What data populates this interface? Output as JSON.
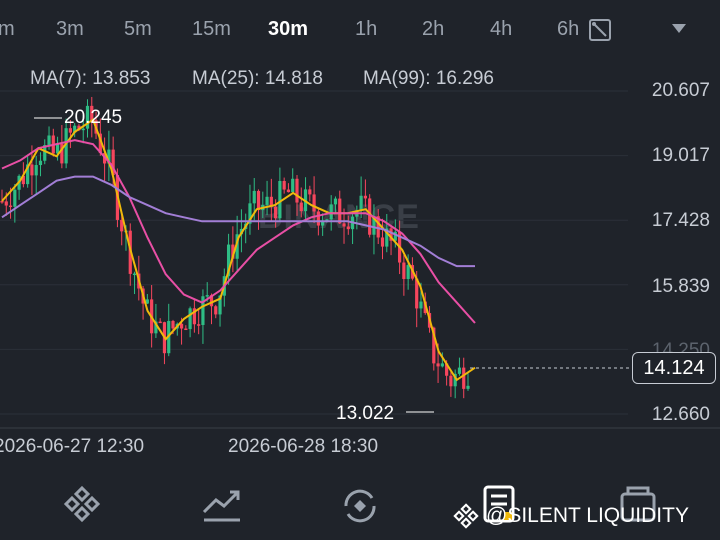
{
  "timeframes": [
    {
      "label": "m",
      "active": false
    },
    {
      "label": "3m",
      "active": false
    },
    {
      "label": "5m",
      "active": false
    },
    {
      "label": "15m",
      "active": false
    },
    {
      "label": "30m",
      "active": true
    },
    {
      "label": "1h",
      "active": false
    },
    {
      "label": "2h",
      "active": false
    },
    {
      "label": "4h",
      "active": false
    },
    {
      "label": "6h",
      "active": false
    }
  ],
  "ma": {
    "ma7": {
      "label": "MA(7): 13.853",
      "color": "#f0b90b"
    },
    "ma25": {
      "label": "MA(25): 14.818",
      "color": "#e84fa5"
    },
    "ma99": {
      "label": "MA(99): 16.296",
      "color": "#a27ed6"
    }
  },
  "colors": {
    "up": "#2ebd85",
    "down": "#f6465d"
  },
  "watermark": "BINANCE",
  "annotations": {
    "high": "20.245",
    "low": "13.022"
  },
  "current_price": "14.124",
  "icons": [
    "drawing-tools-icon",
    "chevron-down-icon",
    "markets-icon",
    "trade-icon",
    "orders-icon",
    "wallet-icon"
  ],
  "credit": "@SILENT LIQUIDITY",
  "chart_data": {
    "type": "line",
    "title": "",
    "y_ticks": [
      "20.607",
      "19.017",
      "17.428",
      "15.839",
      "14.250",
      "12.660"
    ],
    "ylim": [
      12.0,
      21.2
    ],
    "x_ticks": [
      "2026-06-27 12:30",
      "2026-06-28 18:30"
    ],
    "series": [
      {
        "name": "MA(7)",
        "values": [
          17.9,
          18.4,
          19.2,
          19.0,
          19.6,
          19.9,
          18.7,
          16.8,
          15.2,
          14.5,
          15.0,
          15.3,
          15.5,
          17.0,
          17.7,
          17.8,
          18.1,
          17.8,
          17.6,
          17.6,
          17.7,
          17.2,
          16.7,
          15.8,
          14.2,
          13.5,
          13.8
        ]
      },
      {
        "name": "MA(25)",
        "values": [
          18.7,
          18.9,
          19.2,
          19.3,
          19.4,
          19.3,
          18.8,
          18.0,
          17.0,
          16.1,
          15.6,
          15.4,
          15.7,
          16.2,
          16.7,
          17.0,
          17.3,
          17.5,
          17.6,
          17.6,
          17.6,
          17.4,
          17.1,
          16.6,
          15.9,
          15.4,
          14.9
        ]
      },
      {
        "name": "MA(99)",
        "values": [
          17.5,
          17.8,
          18.1,
          18.4,
          18.5,
          18.5,
          18.3,
          18.0,
          17.8,
          17.6,
          17.5,
          17.4,
          17.4,
          17.4,
          17.4,
          17.4,
          17.4,
          17.4,
          17.4,
          17.4,
          17.3,
          17.2,
          17.0,
          16.8,
          16.5,
          16.3,
          16.3
        ]
      }
    ]
  }
}
